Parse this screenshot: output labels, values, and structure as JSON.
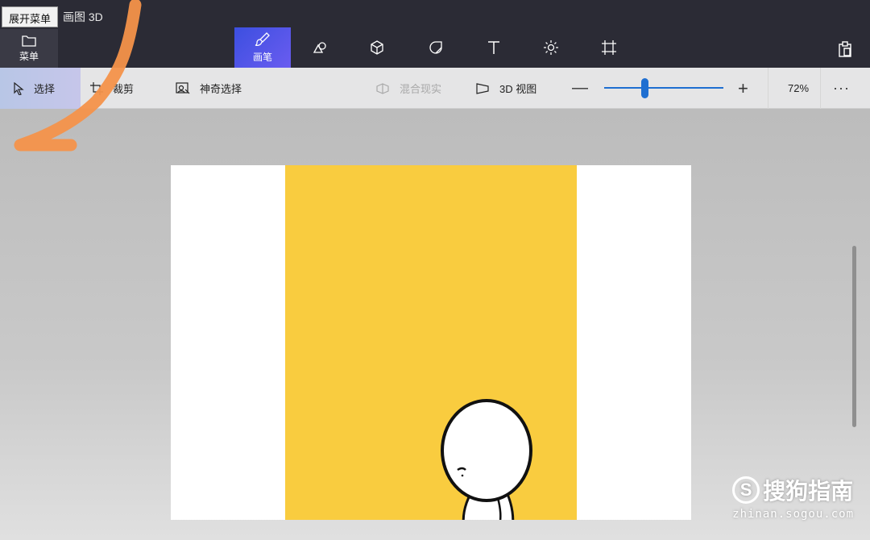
{
  "app": {
    "title": "画图 3D",
    "tooltip": "展开菜单"
  },
  "menu": {
    "label": "菜单"
  },
  "toolbar": {
    "tools": [
      {
        "label": "画笔",
        "icon": "brush-icon",
        "active": true
      },
      {
        "label": "",
        "icon": "2d-shapes-icon"
      },
      {
        "label": "",
        "icon": "3d-shapes-icon"
      },
      {
        "label": "",
        "icon": "stickers-icon"
      },
      {
        "label": "",
        "icon": "text-icon"
      },
      {
        "label": "",
        "icon": "effects-icon"
      },
      {
        "label": "",
        "icon": "canvas-icon"
      }
    ],
    "library_icon": "paste-icon"
  },
  "subbar": {
    "select": "选择",
    "crop": "裁剪",
    "magic_select": "神奇选择",
    "mixed_reality": "混合现实",
    "view_3d": "3D 视图",
    "zoom_minus": "—",
    "zoom_plus": "+",
    "zoom_value": "72%",
    "zoom_fraction": 0.34,
    "more": "···"
  },
  "watermark": {
    "main": "搜狗指南",
    "sub": "zhinan.sogou.com"
  },
  "colors": {
    "topbar": "#2b2b35",
    "accent": "#1f6fd1",
    "canvas_yellow": "#f9cc3f",
    "annotation_stroke": "#f4924a"
  }
}
